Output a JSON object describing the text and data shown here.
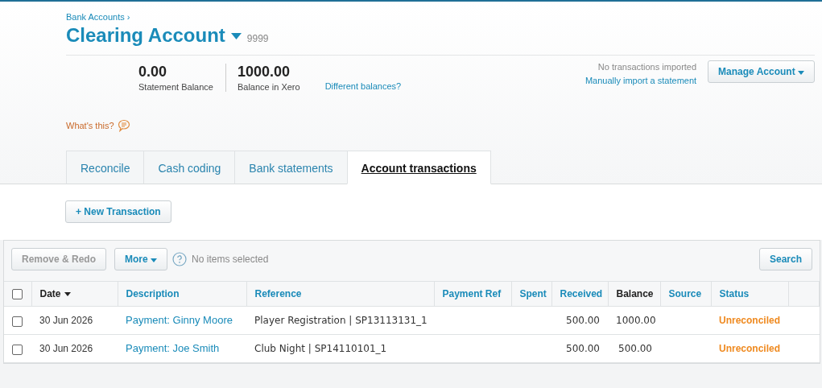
{
  "breadcrumb": "Bank Accounts ›",
  "account": {
    "title": "Clearing Account",
    "code": "9999"
  },
  "balances": [
    {
      "value": "0.00",
      "label": "Statement Balance"
    },
    {
      "value": "1000.00",
      "label": "Balance in Xero"
    }
  ],
  "balance_link": "Different balances?",
  "import_status": "No transactions imported",
  "import_link": "Manually import a statement",
  "manage_button": "Manage Account",
  "help_link": "What's this?",
  "tabs": [
    {
      "label": "Reconcile",
      "selected": false
    },
    {
      "label": "Cash coding",
      "selected": false
    },
    {
      "label": "Bank statements",
      "selected": false
    },
    {
      "label": "Account transactions",
      "selected": true
    }
  ],
  "new_button": "+ New Transaction",
  "toolbar": {
    "remove_button": {
      "label": "Remove & Redo",
      "disabled": true
    },
    "more_button": "More",
    "selection": "No items selected",
    "search_button": "Search"
  },
  "table": {
    "select_all": {
      "checked": false
    },
    "columns": [
      {
        "label": "Date",
        "kind": "plain",
        "sorted": true
      },
      {
        "label": "Description",
        "kind": "link",
        "sorted": false
      },
      {
        "label": "Reference",
        "kind": "link",
        "sorted": false
      },
      {
        "label": "Payment Ref",
        "kind": "link",
        "sorted": false
      },
      {
        "label": "Spent",
        "kind": "link",
        "sorted": false
      },
      {
        "label": "Received",
        "kind": "link",
        "sorted": false
      },
      {
        "label": "Balance",
        "kind": "plain",
        "sorted": false
      },
      {
        "label": "Source",
        "kind": "link",
        "sorted": false
      },
      {
        "label": "Status",
        "kind": "link",
        "sorted": false
      }
    ],
    "rows": [
      {
        "checked": false,
        "date": "30 Jun 2026",
        "description": "Payment: Ginny Moore",
        "reference": "Player Registration | SP13113131_1",
        "received": "500.00",
        "balance": "1000.00",
        "status": "Unreconciled"
      },
      {
        "checked": false,
        "date": "30 Jun 2026",
        "description": "Payment: Joe Smith",
        "reference": "Club Night | SP14110101_1",
        "received": "500.00",
        "balance": "500.00",
        "status": "Unreconciled"
      }
    ]
  }
}
